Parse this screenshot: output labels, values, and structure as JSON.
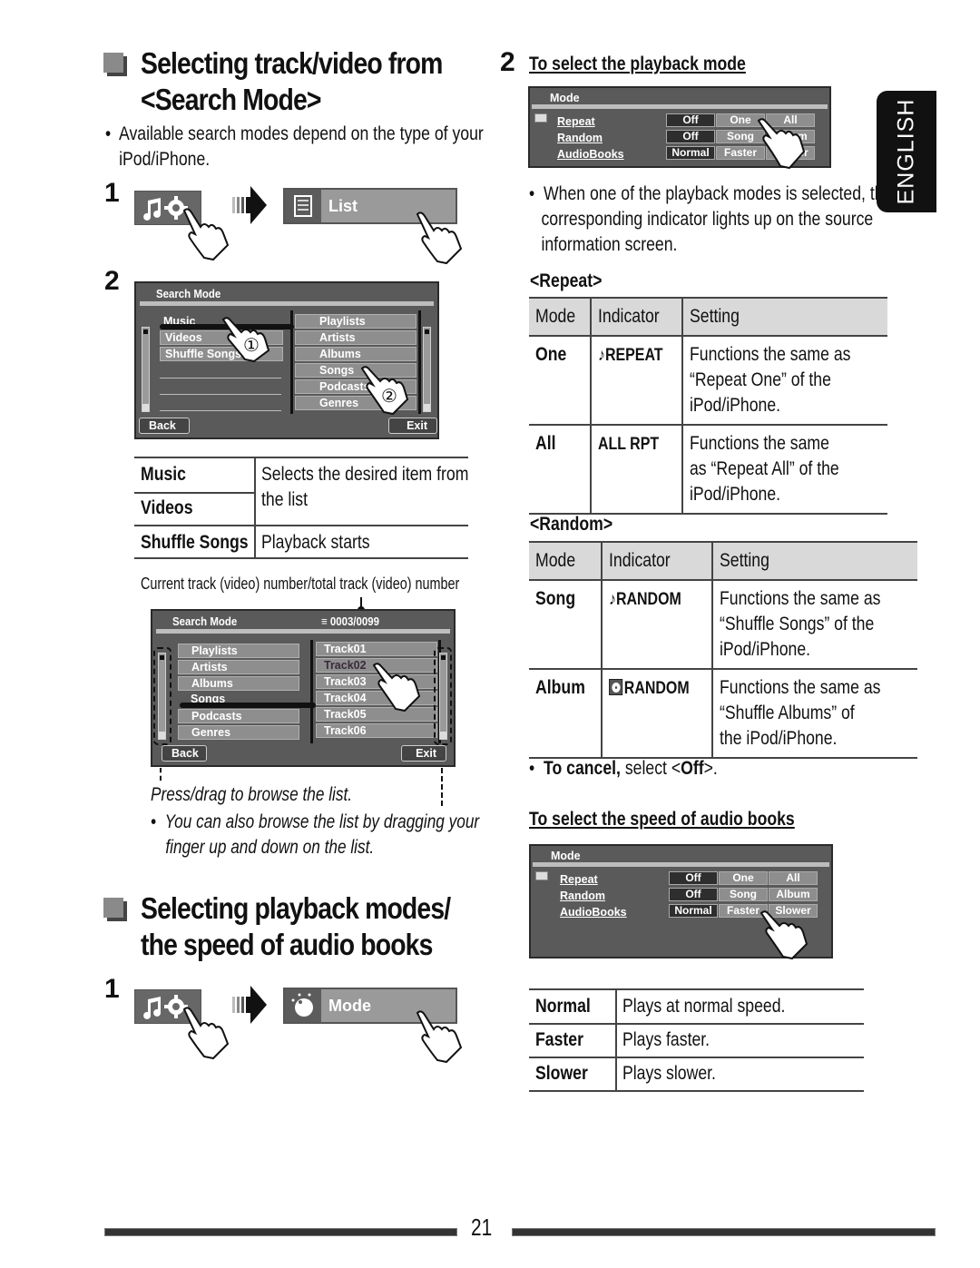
{
  "section1": {
    "heading_line1": "Selecting track/video from",
    "heading_line2": "<Search Mode>",
    "note": "Available search modes depend on the type of your",
    "note_line2": "iPod/iPhone.",
    "step1_num": "1",
    "step1_button_label": "List",
    "step2_num": "2",
    "screen1": {
      "title": "Search Mode",
      "left_items": [
        "Music",
        "Videos",
        "Shuffle Songs"
      ],
      "right_items": [
        "Playlists",
        "Artists",
        "Albums",
        "Songs",
        "Podcasts",
        "Genres"
      ],
      "back_label": "Back",
      "exit_label": "Exit",
      "callout1": "①",
      "callout2": "②"
    },
    "table": [
      {
        "term": "Music",
        "desc": "Selects the desired item from"
      },
      {
        "term": "Videos",
        "desc": "the list"
      },
      {
        "term": "Shuffle Songs",
        "desc": "Playback starts"
      }
    ],
    "caption_counter": "Current track (video) number/total track (video) number",
    "screen2": {
      "title": "Search Mode",
      "counter": "0003/0099",
      "left_items": [
        "Playlists",
        "Artists",
        "Albums",
        "Songs",
        "Podcasts",
        "Genres"
      ],
      "right_items": [
        "Track01",
        "Track02",
        "Track03",
        "Track04",
        "Track05",
        "Track06"
      ],
      "back_label": "Back",
      "exit_label": "Exit"
    },
    "browse_caption": "Press/drag to browse the list.",
    "browse_note_line1": "You can also browse the list by dragging your",
    "browse_note_line2": "finger up and down on the list."
  },
  "section2": {
    "heading_line1": "Selecting playback modes/",
    "heading_line2": "the speed of audio books",
    "step1_num": "1",
    "step1_button_label": "Mode",
    "step2_num": "2",
    "step2_title": "To select the playback mode",
    "mode_screen": {
      "title": "Mode",
      "rows": [
        {
          "label": "Repeat",
          "options": [
            "Off",
            "One",
            "All"
          ]
        },
        {
          "label": "Random",
          "options": [
            "Off",
            "Song",
            "Album"
          ]
        },
        {
          "label": "AudioBooks",
          "options": [
            "Normal",
            "Faster",
            "Slower"
          ]
        }
      ]
    },
    "indicator_note_line1": "When one of the playback modes is selected, the",
    "indicator_note_line2": "corresponding indicator lights up on the source",
    "indicator_note_line3": "information screen.",
    "repeat_heading": "<Repeat>",
    "random_heading": "<Random>",
    "table_headers": [
      "Mode",
      "Indicator",
      "Setting"
    ],
    "repeat_rows": [
      {
        "mode": "One",
        "indicator": "REPEAT",
        "indicator_icon": "note-icon",
        "setting": [
          "Functions the same as",
          "“Repeat One” of the",
          "iPod/iPhone."
        ]
      },
      {
        "mode": "All",
        "indicator": "ALL RPT",
        "indicator_icon": "",
        "setting": [
          "Functions the same",
          "as “Repeat All” of the",
          "iPod/iPhone."
        ]
      }
    ],
    "random_rows": [
      {
        "mode": "Song",
        "indicator": "RANDOM",
        "indicator_icon": "note-icon",
        "setting": [
          "Functions the same as",
          "“Shuffle Songs” of the",
          "iPod/iPhone."
        ]
      },
      {
        "mode": "Album",
        "indicator": "RANDOM",
        "indicator_icon": "disc-icon",
        "setting": [
          "Functions the same as",
          "“Shuffle Albums” of",
          "the iPod/iPhone."
        ]
      }
    ],
    "cancel_bold": "To cancel,",
    "cancel_rest": " select <",
    "cancel_off": "Off",
    "cancel_end": ">.",
    "speed_title": "To select the speed of audio books",
    "speed_rows": [
      {
        "term": "Normal",
        "desc": "Plays at normal speed."
      },
      {
        "term": "Faster",
        "desc": "Plays faster."
      },
      {
        "term": "Slower",
        "desc": "Plays slower."
      }
    ]
  },
  "language_tab": "ENGLISH",
  "page_number": "21"
}
